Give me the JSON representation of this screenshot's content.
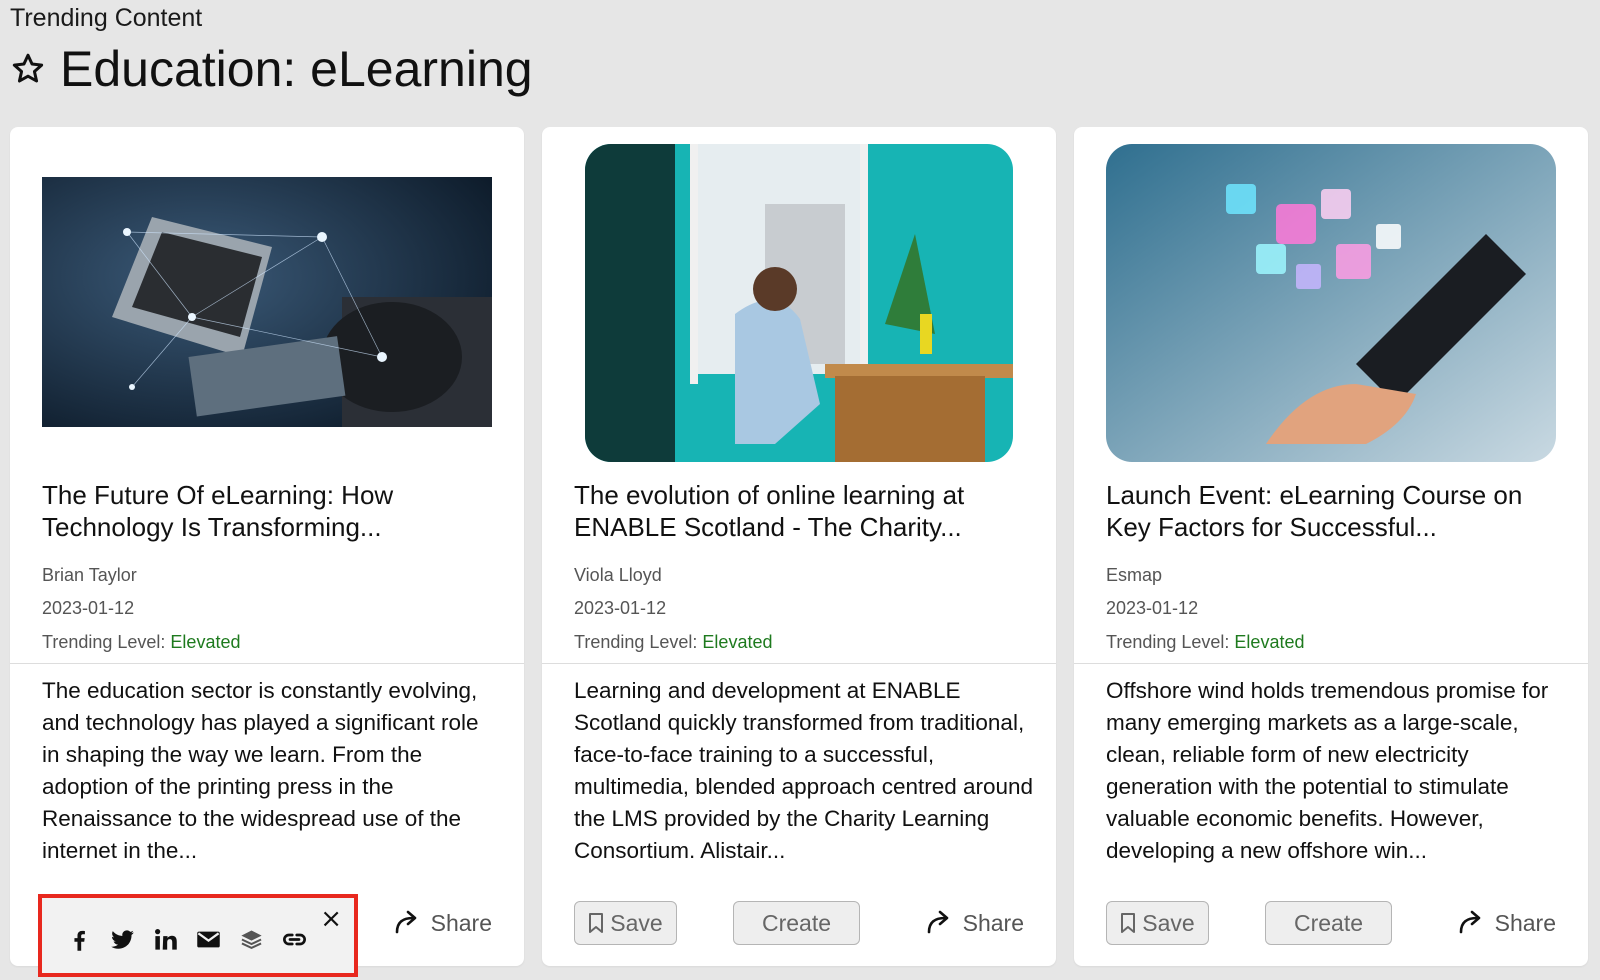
{
  "header": {
    "section_label": "Trending Content",
    "title": "Education: eLearning",
    "favorite_icon": "star-outline-icon"
  },
  "cards": [
    {
      "title": "The Future Of eLearning: How Technology Is Transforming...",
      "author": "Brian Taylor",
      "date": "2023-01-12",
      "trending_prefix": "Trending Level: ",
      "trending_level": "Elevated",
      "description": "The education sector is constantly evolving, and technology has played a significant role in shaping the way we learn. From the adoption of the printing press in the Renaissance to the widespread use of the internet in the...",
      "share_label": "Share"
    },
    {
      "title": "The evolution of online learning at ENABLE Scotland - The Charity...",
      "author": "Viola Lloyd",
      "date": "2023-01-12",
      "trending_prefix": "Trending Level: ",
      "trending_level": "Elevated",
      "description": "Learning and development at ENABLE Scotland quickly transformed from traditional, face-to-face training to a successful, multimedia, blended approach centred around the LMS provided by the Charity Learning Consortium. Alistair...",
      "save_label": "Save",
      "create_label": "Create",
      "share_label": "Share"
    },
    {
      "title": "Launch Event: eLearning Course on Key Factors for Successful...",
      "author": "Esmap",
      "date": "2023-01-12",
      "trending_prefix": "Trending Level: ",
      "trending_level": "Elevated",
      "description": "Offshore wind holds tremendous promise for many emerging markets as a large-scale, clean, reliable form of new electricity generation with the potential to stimulate valuable economic benefits. However, developing a new offshore win...",
      "save_label": "Save",
      "create_label": "Create",
      "share_label": "Share"
    }
  ],
  "share_popover": {
    "icons": [
      "facebook-icon",
      "twitter-icon",
      "linkedin-icon",
      "email-icon",
      "buffer-icon",
      "link-icon"
    ],
    "close": "×"
  },
  "colors": {
    "background": "#e6e6e6",
    "trending_level": "#1e7a1e",
    "popover_border": "#e8281e"
  }
}
